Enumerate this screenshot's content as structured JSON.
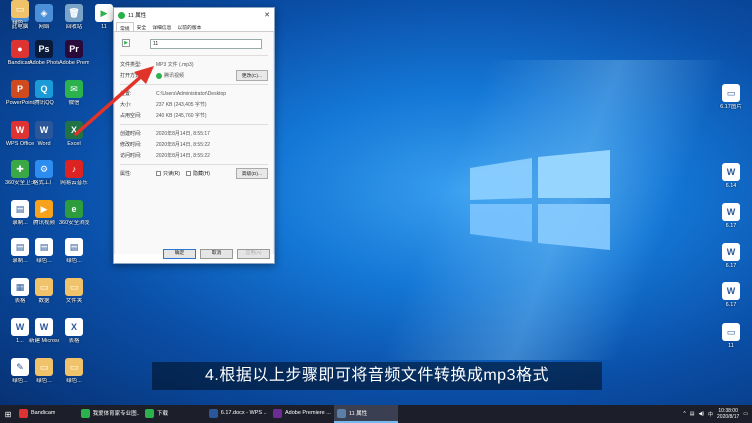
{
  "desktop": {
    "icons_left": [
      {
        "label": "此电脑",
        "color": "#4a8fd8",
        "glyph": "▭"
      },
      {
        "label": "网络",
        "color": "#4a8fd8",
        "glyph": "◈"
      },
      {
        "label": "回收站",
        "color": "#7aa3c8",
        "glyph": "🗑"
      },
      {
        "label": "Bandicam",
        "color": "#d33",
        "glyph": "●"
      },
      {
        "label": "Adobe Photosh...",
        "color": "#0a1a3a",
        "glyph": "Ps"
      },
      {
        "label": "Adobe Premie...",
        "color": "#2a0a3a",
        "glyph": "Pr"
      },
      {
        "label": "PowerPoint",
        "color": "#d04a1f",
        "glyph": "P"
      },
      {
        "label": "腾讯QQ",
        "color": "#1a9bd8",
        "glyph": "Q"
      },
      {
        "label": "微信",
        "color": "#2bb24c",
        "glyph": "✉"
      },
      {
        "label": "WPS Office",
        "color": "#d33",
        "glyph": "W"
      },
      {
        "label": "Word",
        "color": "#2b579a",
        "glyph": "W"
      },
      {
        "label": "Excel",
        "color": "#217346",
        "glyph": "X"
      },
      {
        "label": "360安全卫士",
        "color": "#39a845",
        "glyph": "✚"
      },
      {
        "label": "格式工厂",
        "color": "#2d8cf0",
        "glyph": "⚙"
      },
      {
        "label": "网易云音乐",
        "color": "#d22",
        "glyph": "♪"
      },
      {
        "label": "录制...",
        "color": "#fff",
        "glyph": "▤"
      },
      {
        "label": "腾讯视频",
        "color": "#f7a21b",
        "glyph": "▶"
      },
      {
        "label": "360安全浏览器",
        "color": "#2d9c3c",
        "glyph": "e"
      },
      {
        "label": "录制...",
        "color": "#fff",
        "glyph": "▤"
      },
      {
        "label": "绿色...",
        "color": "#fff",
        "glyph": "▤"
      },
      {
        "label": "绿色...",
        "color": "#fff",
        "glyph": "▤"
      },
      {
        "label": "表格",
        "color": "#fff",
        "glyph": "▦"
      },
      {
        "label": "数据",
        "color": "#f0c36a",
        "glyph": "▭"
      },
      {
        "label": "文件夹",
        "color": "#f0c36a",
        "glyph": "▭"
      },
      {
        "label": "1...",
        "color": "#fff",
        "glyph": "W"
      },
      {
        "label": "新建 Microsoft...",
        "color": "#fff",
        "glyph": "W"
      },
      {
        "label": "表格",
        "color": "#fff",
        "glyph": "X"
      },
      {
        "label": "绿色...",
        "color": "#fff",
        "glyph": "✎"
      },
      {
        "label": "绿色...",
        "color": "#f0c36a",
        "glyph": "▭"
      },
      {
        "label": "绿色...",
        "color": "#f0c36a",
        "glyph": "▭"
      },
      {
        "label": "绿色...",
        "color": "#f0c36a",
        "glyph": "▭"
      }
    ],
    "icon_11": "11",
    "icons_right": [
      {
        "label": "6.17图片",
        "glyph": "▭"
      },
      {
        "label": "6.14",
        "glyph": "W"
      },
      {
        "label": "6.17",
        "glyph": "W"
      },
      {
        "label": "6.17",
        "glyph": "W"
      },
      {
        "label": "6.17",
        "glyph": "W"
      },
      {
        "label": "11",
        "glyph": "▭"
      }
    ]
  },
  "dialog": {
    "title": "11 属性",
    "tabs": [
      "常规",
      "安全",
      "详细信息",
      "以前的版本"
    ],
    "filename": "11",
    "rows": {
      "file_type_k": "文件类型:",
      "file_type_v": "MP3 文件 (.mp3)",
      "open_with_k": "打开方式:",
      "open_with_v": "腾讯视频",
      "change_btn": "更改(C)...",
      "location_k": "位置:",
      "location_v": "C:\\Users\\Administrator\\Desktop",
      "size_k": "大小:",
      "size_v": "237 KB (243,405 字节)",
      "size_disk_k": "占用空间:",
      "size_disk_v": "240 KB (245,760 字节)",
      "created_k": "创建时间:",
      "created_v": "2020年8月14日, 8:55:17",
      "modified_k": "修改时间:",
      "modified_v": "2020年8月14日, 8:55:22",
      "accessed_k": "访问时间:",
      "accessed_v": "2020年8月14日, 8:55:22",
      "attr_k": "属性:",
      "readonly": "只读(R)",
      "hidden": "隐藏(H)",
      "advanced_btn": "高级(D)..."
    },
    "buttons": {
      "ok": "确定",
      "cancel": "取消",
      "apply": "应用(A)"
    }
  },
  "subtitle": "4.根据以上步骤即可将音频文件转换成mp3格式",
  "taskbar": {
    "items": [
      {
        "label": "Bandicam",
        "color": "#d33"
      },
      {
        "label": "我爱体育家专业图...",
        "color": "#2bb24c"
      },
      {
        "label": "下载",
        "color": "#2bb24c"
      },
      {
        "label": "6.17.docx - WPS ...",
        "color": "#2b579a"
      },
      {
        "label": "Adobe Premiere ...",
        "color": "#6b2d91"
      },
      {
        "label": "11 属性",
        "color": "#5a7fa8"
      }
    ],
    "time": "10:38:00",
    "date": "2020/8/17"
  },
  "colors": {
    "accent": "#1477d6",
    "arrow": "#e0332a"
  }
}
